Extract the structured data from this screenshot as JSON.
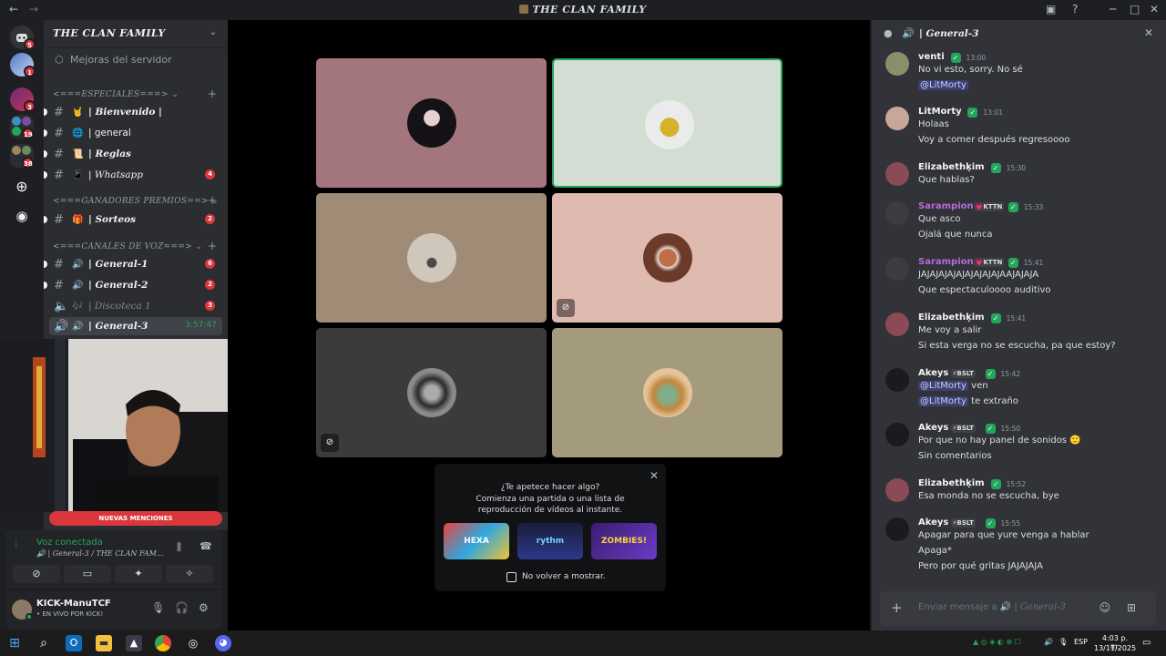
{
  "window": {
    "title": "THE CLAN FAMILY",
    "icon": "server-emoji-icon"
  },
  "server": {
    "name": "THE CLAN FAMILY",
    "boost_label": "Mejoras del servidor",
    "categories": [
      {
        "name": "<===ESPECIALES===>"
      },
      {
        "name": "<===GANADORES PREMIOS==>"
      },
      {
        "name": "<===CANALES DE VOZ===>"
      }
    ],
    "channels": [
      {
        "label": "| Bienvenido |",
        "type": "text",
        "badge": ""
      },
      {
        "label": "| general",
        "type": "text",
        "badge": ""
      },
      {
        "label": "| Reglas",
        "type": "text",
        "badge": ""
      },
      {
        "label": "| Whatsapp",
        "type": "text",
        "badge": "4"
      },
      {
        "label": "| Sorteos",
        "type": "text",
        "badge": "2"
      },
      {
        "label": "| General-1",
        "type": "voice",
        "badge": "6"
      },
      {
        "label": "| General-2",
        "type": "voice",
        "badge": "2"
      },
      {
        "label": "| Discoteca 1",
        "type": "voice",
        "badge": "3"
      },
      {
        "label": "| General-3",
        "type": "voice",
        "badge": "",
        "time": "3:57:47"
      }
    ],
    "rail_badges": [
      "5",
      "1",
      "3",
      "19",
      "38"
    ]
  },
  "mentions_label": "NUEVAS MENCIONES",
  "voice": {
    "status": "Voz conectada",
    "channel": "| General-3 / THE CLAN FAM..."
  },
  "user": {
    "name": "KICK-ManuTCF",
    "status": "• EN VIVO POR KICK!"
  },
  "activity_popup": {
    "title": "¿Te apetece hacer algo?",
    "subtitle": "Comienza una partida o una lista de reproducción de vídeos al instante.",
    "games": [
      "HEXA",
      "rythm",
      "ZOMBIES!"
    ],
    "checkbox_label": "No volver a mostrar."
  },
  "chat": {
    "channel": "| General-3",
    "input_placeholder": "Enviar mensaje a",
    "input_channel": "| General-3",
    "messages": [
      {
        "author": "venti",
        "color": "#f2f3f5",
        "tag": "",
        "time": "13:00",
        "lines": [
          "No vi esto, sorry. No sé",
          "@LitMorty"
        ]
      },
      {
        "author": "LitMorty",
        "color": "#f2f3f5",
        "tag": "",
        "time": "13:01",
        "lines": [
          "Holaas",
          "Voy a comer después regresoooo"
        ]
      },
      {
        "author": "Elizabethḳim",
        "color": "#f2f3f5",
        "tag": "",
        "time": "15:30",
        "lines": [
          "Que hablas?"
        ]
      },
      {
        "author": "Sarampion",
        "color": "#b86cd9",
        "tag": "💗KTTN",
        "time": "15:33",
        "lines": [
          "Que asco",
          "Ojalá que nunca"
        ]
      },
      {
        "author": "Sarampion",
        "color": "#b86cd9",
        "tag": "💗KTTN",
        "time": "15:41",
        "lines": [
          "JAJAJAJAJAJAJAJAJAJAAJAJAJA",
          "Que espectaculoooo auditivo"
        ]
      },
      {
        "author": "Elizabethḳim",
        "color": "#f2f3f5",
        "tag": "",
        "time": "15:41",
        "lines": [
          "Me voy a salir",
          "Si esta verga no se escucha, pa que estoy?"
        ]
      },
      {
        "author": "Akeys",
        "color": "#f2f3f5",
        "tag": "⚡BSLT",
        "time": "15:42",
        "lines": [
          "@LitMorty ven",
          "@LitMorty te extraño"
        ]
      },
      {
        "author": "Akeys",
        "color": "#f2f3f5",
        "tag": "⚡BSLT",
        "time": "15:50",
        "lines": [
          "Por que no hay panel de sonidos 🙁",
          "Sin comentarios"
        ]
      },
      {
        "author": "Elizabethḳim",
        "color": "#f2f3f5",
        "tag": "",
        "time": "15:52",
        "lines": [
          "Esa monda no se escucha, bye"
        ]
      },
      {
        "author": "Akeys",
        "color": "#f2f3f5",
        "tag": "⚡BSLT",
        "time": "15:55",
        "lines": [
          "Apagar para que yure venga a hablar",
          "Apaga*",
          "Pero por qué gritas JAJAJAJA"
        ]
      }
    ]
  },
  "taskbar": {
    "lang": "ESP",
    "time": "4:03 p. m.",
    "date": "13/11/2025"
  },
  "colors": {
    "accent": "#5865f2",
    "online": "#23a55a",
    "badge": "#da373c"
  }
}
